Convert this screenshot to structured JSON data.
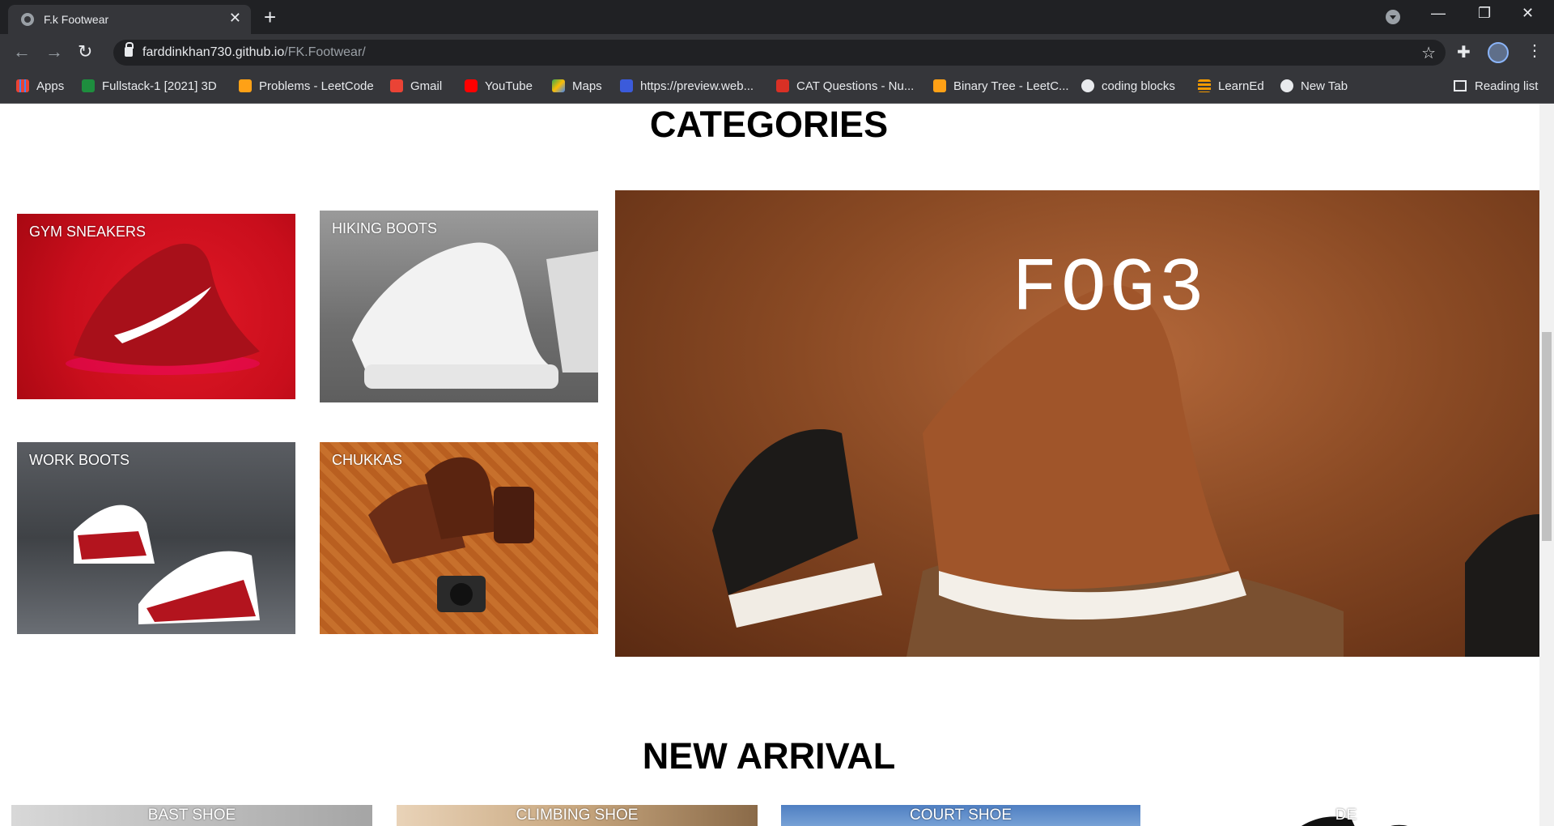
{
  "browser": {
    "tab_title": "F.k Footwear",
    "url_host": "farddinkhan730.github.io",
    "url_path": "/FK.Footwear/",
    "bookmarks": [
      {
        "label": "Apps",
        "icon": "apps-grid-icon",
        "color": "#4285f4"
      },
      {
        "label": "Fullstack-1 [2021] 3D",
        "icon": "classroom-icon",
        "color": "#1e8e3e"
      },
      {
        "label": "Problems - LeetCode",
        "icon": "leetcode-icon",
        "color": "#ffa116"
      },
      {
        "label": "Gmail",
        "icon": "gmail-icon",
        "color": "#ea4335"
      },
      {
        "label": "YouTube",
        "icon": "youtube-icon",
        "color": "#ff0000"
      },
      {
        "label": "Maps",
        "icon": "maps-icon",
        "color": "#34a853"
      },
      {
        "label": "https://preview.web...",
        "icon": "webflow-icon",
        "color": "#3b5bdb"
      },
      {
        "label": "CAT Questions - Nu...",
        "icon": "cat-icon",
        "color": "#d93025"
      },
      {
        "label": "Binary Tree - LeetC...",
        "icon": "leetcode-icon",
        "color": "#ffa116"
      },
      {
        "label": "coding blocks",
        "icon": "github-icon",
        "color": "#e8eaed"
      },
      {
        "label": "LearnEd",
        "icon": "learned-icon",
        "color": "#f29900"
      },
      {
        "label": "New Tab",
        "icon": "globe-icon",
        "color": "#e8eaed"
      }
    ],
    "reading_list": "Reading list"
  },
  "page": {
    "categories_heading": "CATEGORIES",
    "categories": [
      {
        "label": "GYM SNEAKERS"
      },
      {
        "label": "HIKING BOOTS"
      },
      {
        "label": "WORK BOOTS"
      },
      {
        "label": "CHUKKAS"
      }
    ],
    "hero_brand": "FOG3",
    "new_arrival_heading": "NEW ARRIVAL",
    "arrivals": [
      {
        "label": "BAST SHOE"
      },
      {
        "label": "CLIMBING SHOE"
      },
      {
        "label": "COURT SHOE"
      },
      {
        "label": "DE"
      }
    ]
  }
}
